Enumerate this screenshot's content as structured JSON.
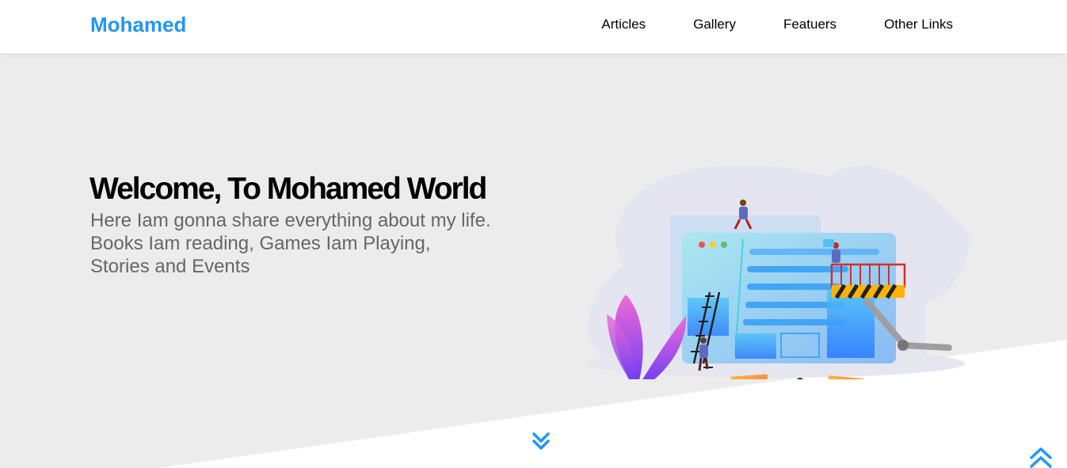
{
  "header": {
    "logo": "Mohamed",
    "nav": [
      "Articles",
      "Gallery",
      "Featuers",
      "Other Links"
    ]
  },
  "landing": {
    "title": "Welcome, To Mohamed World",
    "description": "Here Iam gonna share everything about my life. Books Iam reading, Games Iam Playing, Stories and Events",
    "illustration": "team-building-website-illustration"
  },
  "icons": {
    "go_down": "double-chevron-down-icon",
    "scroll_up": "double-chevron-up-icon"
  },
  "colors": {
    "accent": "#2196f3",
    "landing_bg": "#ececec",
    "text_muted": "#666666"
  }
}
